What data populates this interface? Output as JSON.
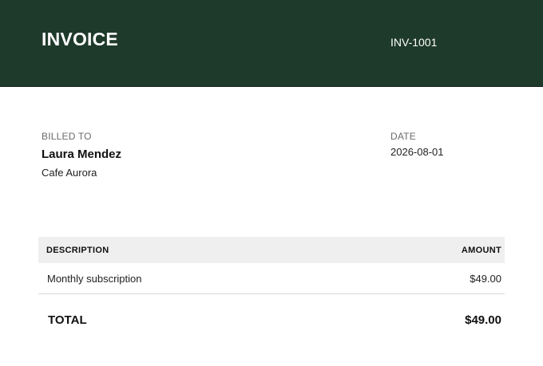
{
  "header": {
    "title": "INVOICE",
    "invoice_number": "INV-1001",
    "background_color": "#1e3a2b"
  },
  "billed_to": {
    "label": "BILLED TO",
    "name": "Laura Mendez",
    "company": "Cafe Aurora"
  },
  "date": {
    "label": "DATE",
    "value": "2026-08-01"
  },
  "table": {
    "columns": [
      "DESCRIPTION",
      "AMOUNT"
    ],
    "rows": [
      {
        "description": "Monthly subscription",
        "amount": "$49.00"
      }
    ]
  },
  "total": {
    "label": "TOTAL",
    "value": "$49.00"
  }
}
